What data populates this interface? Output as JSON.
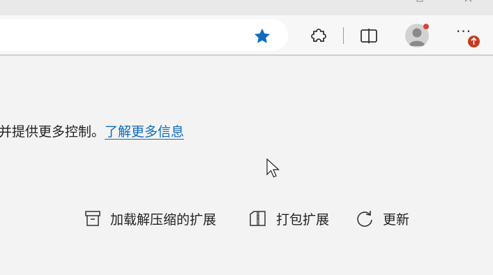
{
  "toolbar": {
    "favorite_icon": "star-filled-icon",
    "extensions_icon": "puzzle-icon",
    "split_icon": "split-screen-icon",
    "profile_icon": "avatar-icon",
    "more_label": "···",
    "update_badge_icon": "arrow-up-icon"
  },
  "content": {
    "info_text": "并提供更多控制。",
    "learn_more": "了解更多信息"
  },
  "actions": {
    "load_unpacked": "加载解压缩的扩展",
    "pack": "打包扩展",
    "update": "更新"
  },
  "colors": {
    "accent": "#0f6cbd",
    "badge": "#c73a1f"
  }
}
